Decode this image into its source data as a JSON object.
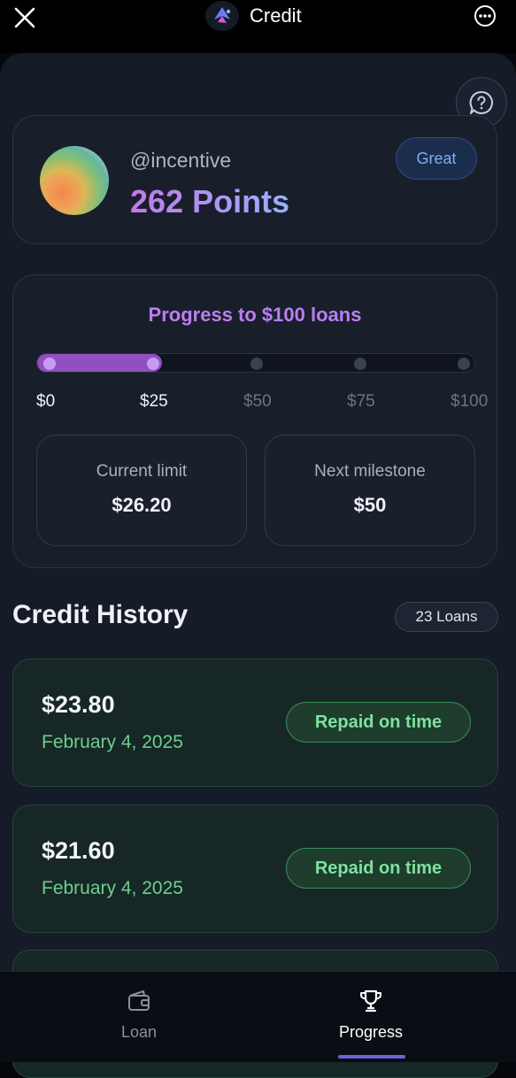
{
  "header": {
    "title": "Credit",
    "close_icon": "close-icon",
    "more_icon": "more-icon",
    "logo_icon": "app-logo-icon"
  },
  "help": {
    "icon": "chat-help-icon"
  },
  "profile": {
    "handle": "@incentive",
    "points": "262 Points",
    "badge": "Great",
    "avatar": "gradient-avatar"
  },
  "progress": {
    "title": "Progress to $100 loans",
    "value_fraction": 0.262,
    "ticks": [
      "$0",
      "$25",
      "$50",
      "$75",
      "$100"
    ],
    "reached_ticks": 2,
    "current_limit_label": "Current limit",
    "current_limit_value": "$26.20",
    "next_milestone_label": "Next milestone",
    "next_milestone_value": "$50"
  },
  "history": {
    "title": "Credit History",
    "count": "23 Loans",
    "loans": [
      {
        "amount": "$23.80",
        "date": "February 4, 2025",
        "status": "Repaid on time"
      },
      {
        "amount": "$21.60",
        "date": "February 4, 2025",
        "status": "Repaid on time"
      }
    ]
  },
  "nav": {
    "items": [
      {
        "label": "Loan",
        "icon": "wallet-icon",
        "active": false
      },
      {
        "label": "Progress",
        "icon": "trophy-icon",
        "active": true
      }
    ]
  },
  "colors": {
    "accent": "#bb7ef2",
    "positive": "#6bcf8e",
    "progress_fill": "#9150c0",
    "nav_indicator": "#6c63d8"
  }
}
